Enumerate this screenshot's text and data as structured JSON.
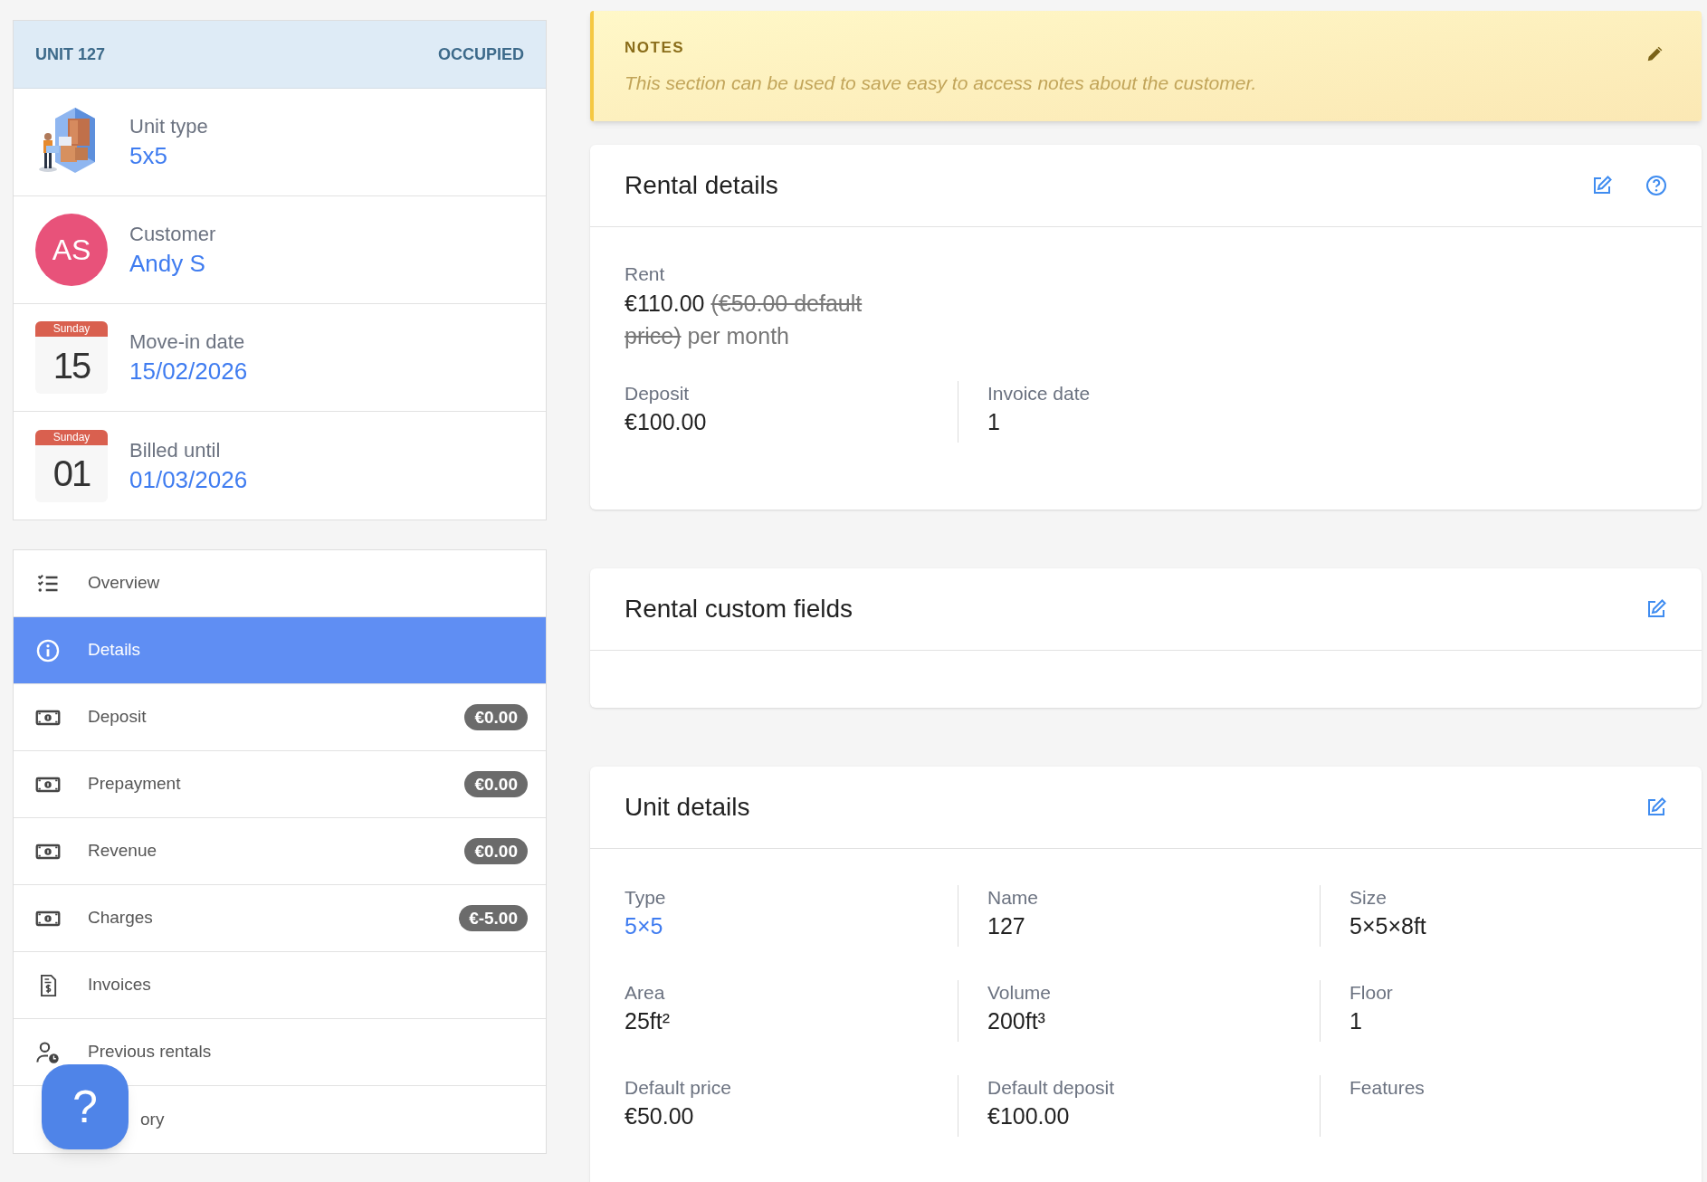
{
  "unit_card": {
    "title": "UNIT 127",
    "status": "OCCUPIED",
    "rows": [
      {
        "kind": "unit_type",
        "label": "Unit type",
        "value": "5x5"
      },
      {
        "kind": "avatar",
        "label": "Customer",
        "value": "Andy S",
        "initials": "AS",
        "color": "#e8527a"
      },
      {
        "kind": "calendar",
        "label": "Move-in date",
        "value": "15/02/2026",
        "weekday": "Sunday",
        "day": "15"
      },
      {
        "kind": "calendar",
        "label": "Billed until",
        "value": "01/03/2026",
        "weekday": "Sunday",
        "day": "01"
      }
    ]
  },
  "menu": [
    {
      "label": "Overview",
      "kind": "checklist",
      "selected": false
    },
    {
      "label": "Details",
      "kind": "info",
      "selected": true
    },
    {
      "label": "Deposit",
      "kind": "money",
      "selected": false,
      "badge": "€0.00"
    },
    {
      "label": "Prepayment",
      "kind": "money",
      "selected": false,
      "badge": "€0.00"
    },
    {
      "label": "Revenue",
      "kind": "money",
      "selected": false,
      "badge": "€0.00"
    },
    {
      "label": "Charges",
      "kind": "money",
      "selected": false,
      "badge": "€-5.00"
    },
    {
      "label": "Invoices",
      "kind": "invoice",
      "selected": false
    },
    {
      "label": "Previous rentals",
      "kind": "history",
      "selected": false
    },
    {
      "label": "ory",
      "kind": "covered",
      "selected": false
    }
  ],
  "help_button": {
    "label": "?"
  },
  "notes": {
    "title": "NOTES",
    "text": "This section can be used to save easy to access notes about the customer."
  },
  "rental_details": {
    "title": "Rental details",
    "rent": {
      "label": "Rent",
      "amount": "€110.00",
      "default_price": "(€50.00 default price)",
      "period": "per month"
    },
    "fields": [
      {
        "label": "Deposit",
        "value": "€100.00"
      },
      {
        "label": "Invoice date",
        "value": "1"
      }
    ]
  },
  "rental_custom_fields": {
    "title": "Rental custom fields"
  },
  "unit_details": {
    "title": "Unit details",
    "fields": [
      {
        "label": "Type",
        "value": "5×5",
        "link": true
      },
      {
        "label": "Name",
        "value": "127",
        "link": false
      },
      {
        "label": "Size",
        "value": "5×5×8ft",
        "link": false
      },
      {
        "label": "Area",
        "value": "25ft²",
        "link": false
      },
      {
        "label": "Volume",
        "value": "200ft³",
        "link": false
      },
      {
        "label": "Floor",
        "value": "1",
        "link": false
      },
      {
        "label": "Default price",
        "value": "€50.00",
        "link": false
      },
      {
        "label": "Default deposit",
        "value": "€100.00",
        "link": false
      },
      {
        "label": "Features"
      }
    ]
  }
}
